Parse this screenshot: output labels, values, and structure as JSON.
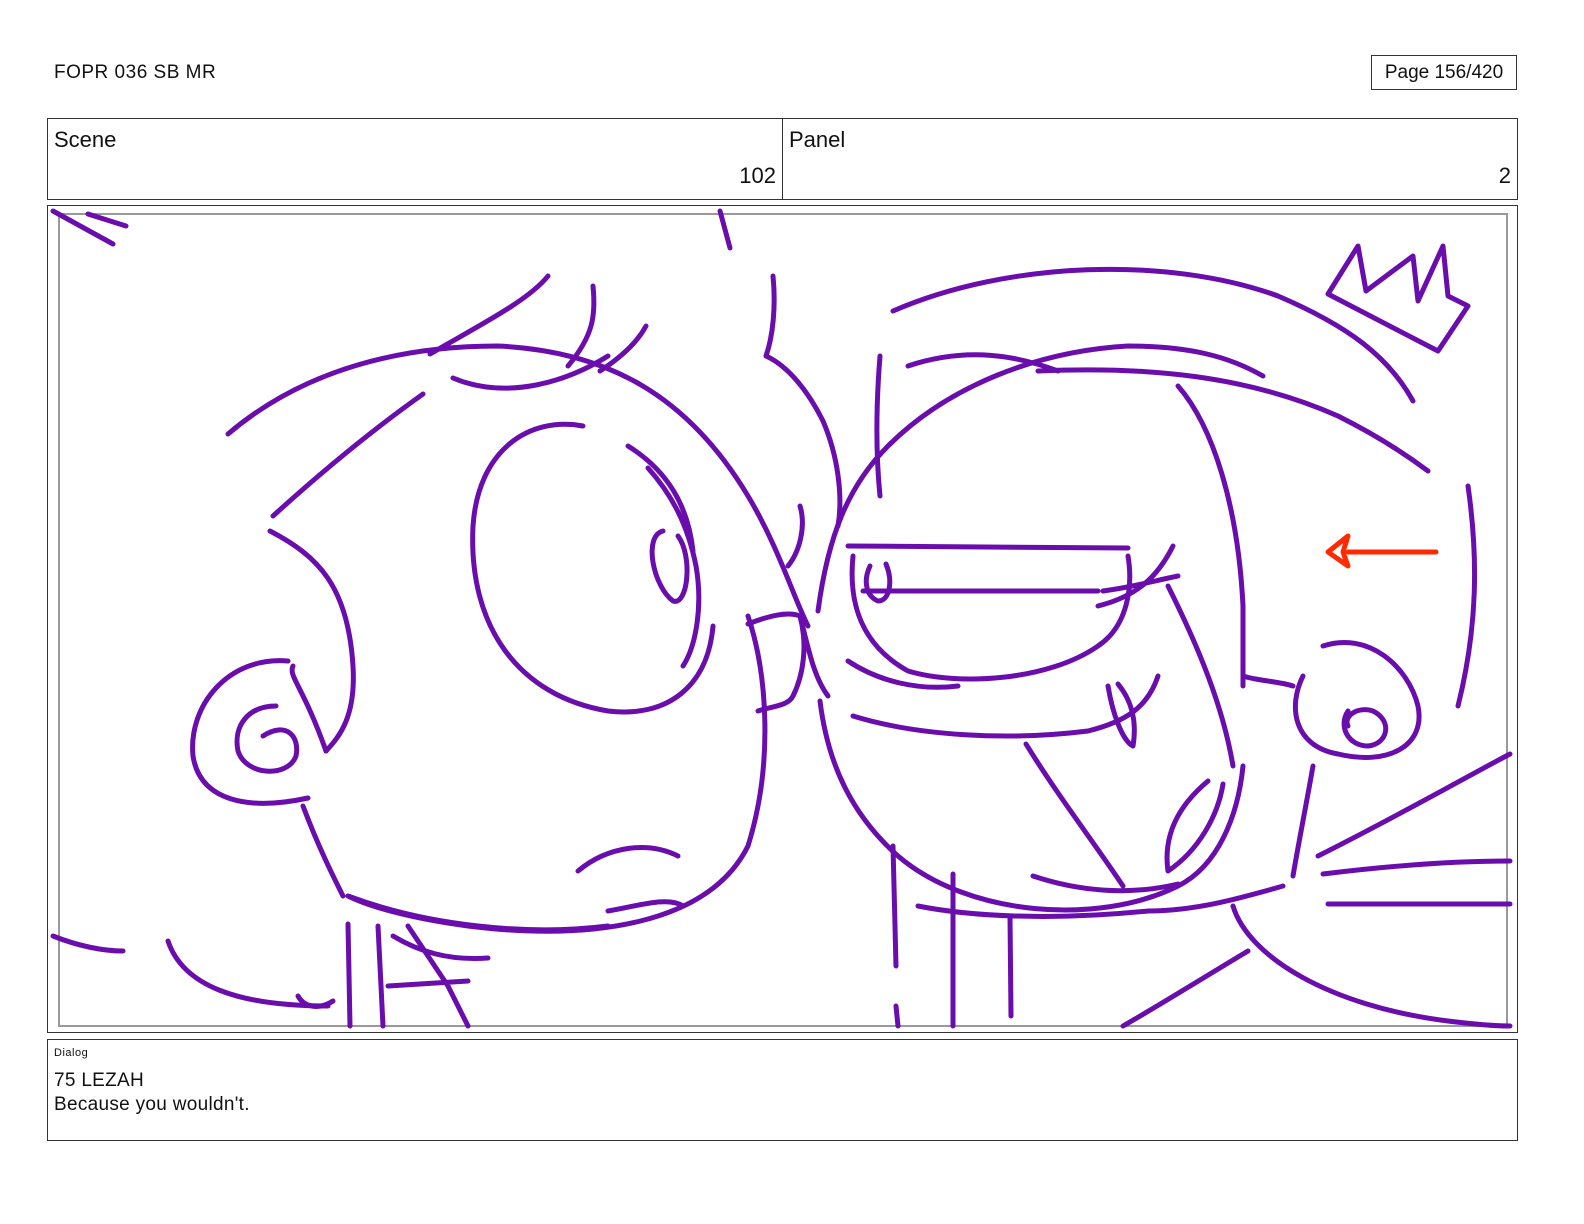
{
  "header": {
    "doc_title": "FOPR 036 SB MR",
    "page_label": "Page 156/420"
  },
  "scene": {
    "label": "Scene",
    "value": "102"
  },
  "panel": {
    "label": "Panel",
    "value": "2"
  },
  "artwork": {
    "line_color": "#6a0dad",
    "arrow_color": "#ff2a00",
    "frame_color": "#999999"
  },
  "dialog": {
    "label": "Dialog",
    "speaker": "75 LEZAH",
    "line": "Because you wouldn't."
  }
}
